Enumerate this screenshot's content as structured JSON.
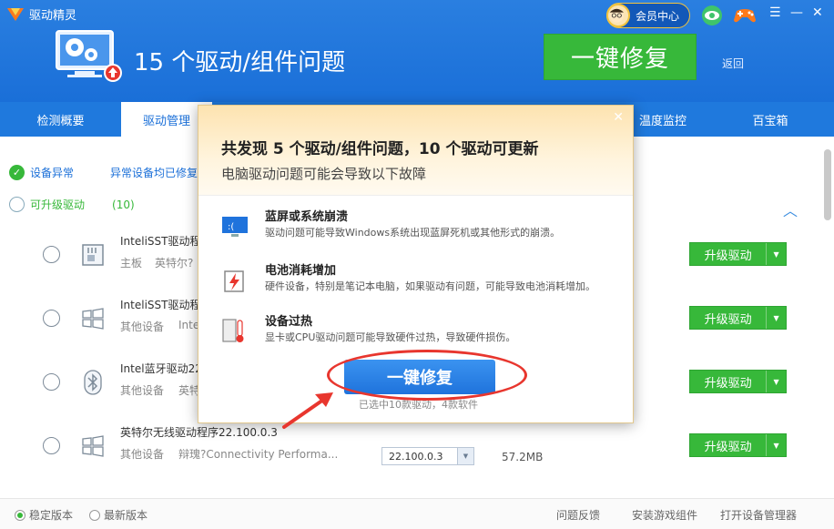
{
  "app": {
    "title": "驱动精灵",
    "member_label": "会员中心",
    "back_label": "返回"
  },
  "header": {
    "problem_title": "15 个驱动/组件问题",
    "fix_button": "一键修复"
  },
  "tabs": [
    {
      "label": "检测概要"
    },
    {
      "label": "驱动管理"
    },
    {
      "label": "温度监控"
    },
    {
      "label": "百宝箱"
    }
  ],
  "sections": {
    "abnormal": {
      "label": "设备异常",
      "info": "异常设备均已修复"
    },
    "upgradable": {
      "label": "可升级驱动",
      "count": "(10)"
    }
  },
  "drivers": [
    {
      "name": "InteliSST驱动程",
      "category": "主板",
      "desc": "英特尔?",
      "button": "升级驱动",
      "icon": "chip-icon"
    },
    {
      "name": "InteliSST驱动程",
      "category": "其他设备",
      "desc": "Inte",
      "button": "升级驱动",
      "icon": "windows-icon"
    },
    {
      "name": "Intel蓝牙驱动22",
      "category": "其他设备",
      "desc": "英特",
      "button": "升级驱动",
      "icon": "bluetooth-icon"
    },
    {
      "name": "英特尔无线驱动程序22.100.0.3",
      "category": "其他设备",
      "desc": "辩瑰?Connectivity Performa...",
      "version": "22.100.0.3",
      "size": "57.2MB",
      "button": "升级驱动",
      "icon": "windows-icon"
    }
  ],
  "footer": {
    "stable": "稳定版本",
    "latest": "最新版本",
    "feedback": "问题反馈",
    "game": "安装游戏组件",
    "device_mgr": "打开设备管理器"
  },
  "dialog": {
    "title": "共发现 5 个驱动/组件问题，10 个驱动可更新",
    "subtitle": "电脑驱动问题可能会导致以下故障",
    "problems": [
      {
        "title": "蓝屏或系统崩溃",
        "desc": "驱动问题可能导致Windows系统出现蓝屏死机或其他形式的崩溃。"
      },
      {
        "title": "电池消耗增加",
        "desc": "硬件设备，特别是笔记本电脑，如果驱动有问题，可能导致电池消耗增加。"
      },
      {
        "title": "设备过热",
        "desc": "显卡或CPU驱动问题可能导致硬件过热，导致硬件损伤。"
      }
    ],
    "fix_button": "一键修复",
    "note": "已选中10款驱动，4款软件"
  },
  "colors": {
    "brand_blue": "#1a6fd8",
    "green": "#37b83a",
    "annotation_red": "#e8362e"
  }
}
